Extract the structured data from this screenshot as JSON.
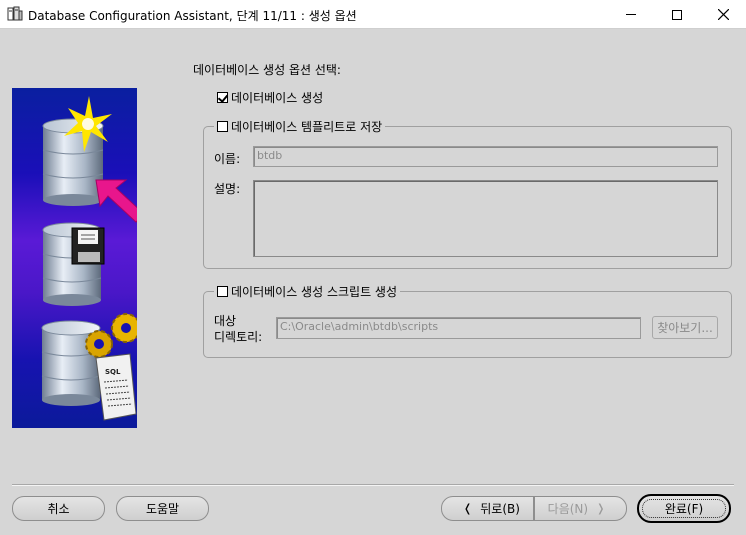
{
  "window": {
    "title": "Database Configuration Assistant, 단계 11/11 : 생성 옵션",
    "controls": {
      "minimize": "minimize-icon",
      "maximize": "maximize-icon",
      "close": "close-icon"
    }
  },
  "main": {
    "heading": "데이터베이스 생성 옵션 선택:",
    "create_db": {
      "label": "데이터베이스 생성",
      "checked": true
    },
    "save_template": {
      "label": "데이터베이스 템플리트로 저장",
      "checked": false,
      "name_label": "이름:",
      "name_value": "btdb",
      "desc_label": "설명:",
      "desc_value": ""
    },
    "gen_scripts": {
      "label": "데이터베이스 생성 스크립트 생성",
      "checked": false,
      "dest_label_line1": "대상",
      "dest_label_line2": "디렉토리:",
      "dest_value": "C:\\Oracle\\admin\\btdb\\scripts",
      "browse_label": "찾아보기..."
    }
  },
  "footer": {
    "cancel": "취소",
    "help": "도움말",
    "back": "뒤로(B)",
    "next": "다음(N)",
    "finish": "완료(F)"
  },
  "colors": {
    "background": "#d6d6d6",
    "illustration_blue": "#1713b0",
    "illustration_purple": "#5a1ad6",
    "arrow_magenta": "#e8168c",
    "disabled_text": "#8a8a8a"
  }
}
